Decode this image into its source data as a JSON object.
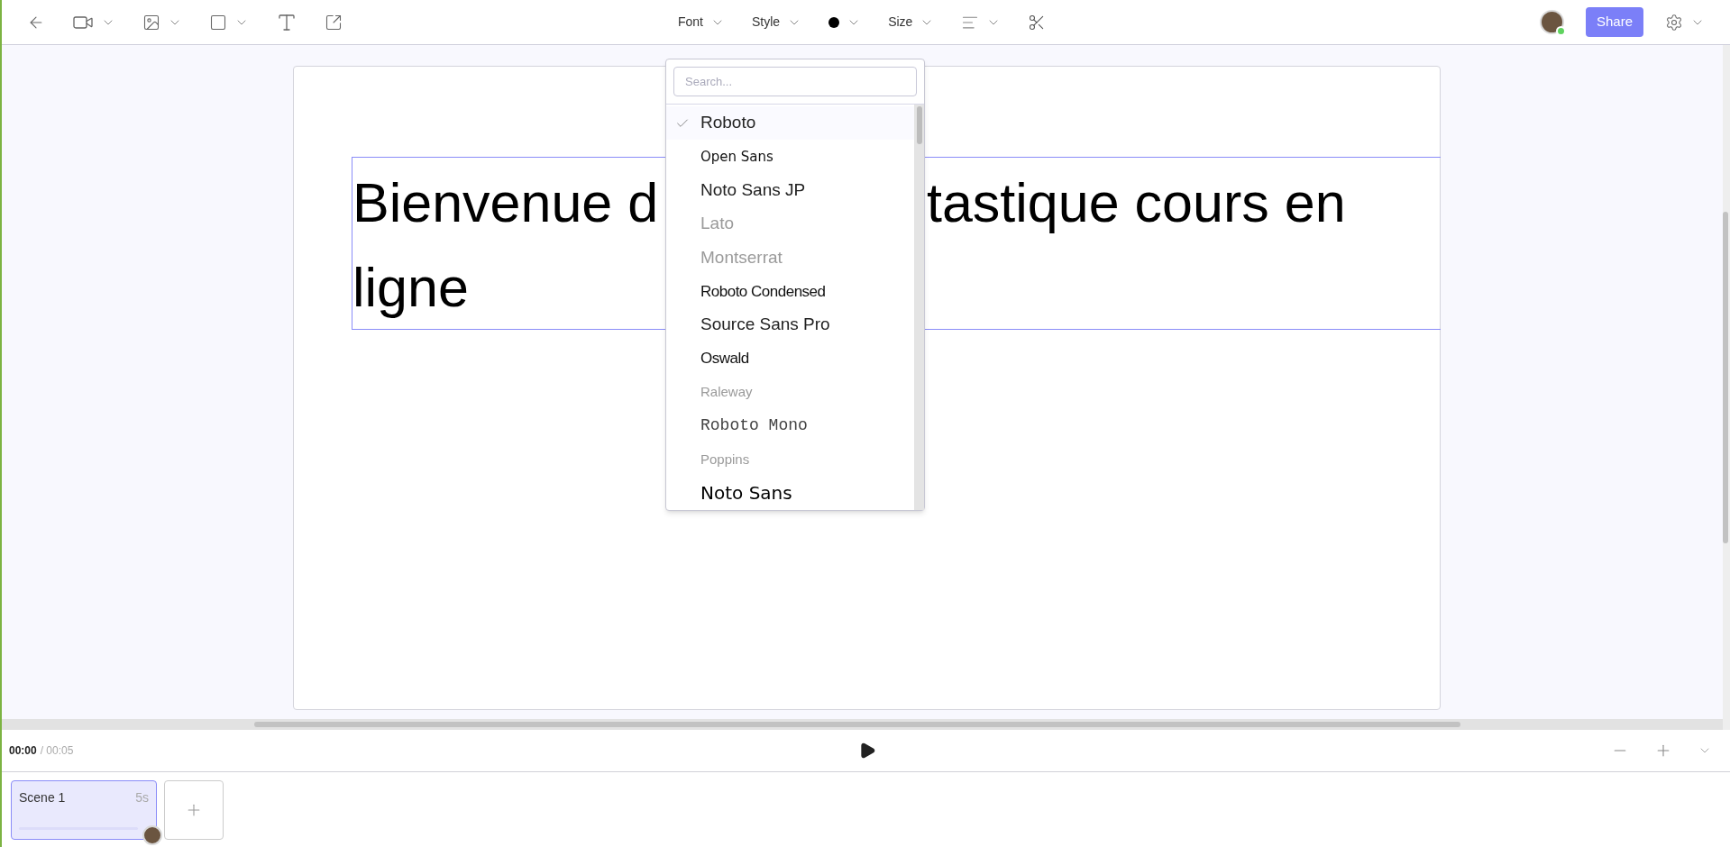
{
  "toolbar": {
    "center": [
      {
        "kind": "menu",
        "label": "Font"
      },
      {
        "kind": "menu",
        "label": "Style"
      },
      {
        "kind": "color"
      },
      {
        "kind": "menu",
        "label": "Size"
      },
      {
        "kind": "align"
      },
      {
        "kind": "scissors"
      }
    ],
    "user": {
      "online": true
    },
    "share_button": "Share"
  },
  "text_box": {
    "line_1_start": "Bienvenue d",
    "line_1_end": "tastique cours en",
    "line_2": "ligne"
  },
  "font_menu": {
    "placeholder": "Search...",
    "fonts": [
      {
        "label": "Roboto",
        "selected": true,
        "kind": "large"
      },
      {
        "label": "Open Sans",
        "selected": false,
        "kind": "small"
      },
      {
        "label": "Noto Sans JP",
        "selected": false,
        "kind": "large"
      },
      {
        "label": "Lato",
        "selected": false,
        "kind": "light"
      },
      {
        "label": "Montserrat",
        "selected": false,
        "kind": "light"
      },
      {
        "label": "Roboto Condensed",
        "selected": false,
        "kind": "condensed"
      },
      {
        "label": "Source Sans Pro",
        "selected": false,
        "kind": "large"
      },
      {
        "label": "Oswald",
        "selected": false,
        "kind": "condensed"
      },
      {
        "label": "Raleway",
        "selected": false,
        "kind": "faint"
      },
      {
        "label": "Roboto Mono",
        "selected": false,
        "kind": "mono"
      },
      {
        "label": "Poppins",
        "selected": false,
        "kind": "faint"
      },
      {
        "label": "Noto Sans",
        "selected": false,
        "kind": "bold"
      }
    ]
  },
  "timeline": {
    "current": "00:00",
    "total": "/ 00:05"
  },
  "scenes": [
    {
      "name": "Scene 1",
      "length": "5s",
      "selected": true
    }
  ]
}
